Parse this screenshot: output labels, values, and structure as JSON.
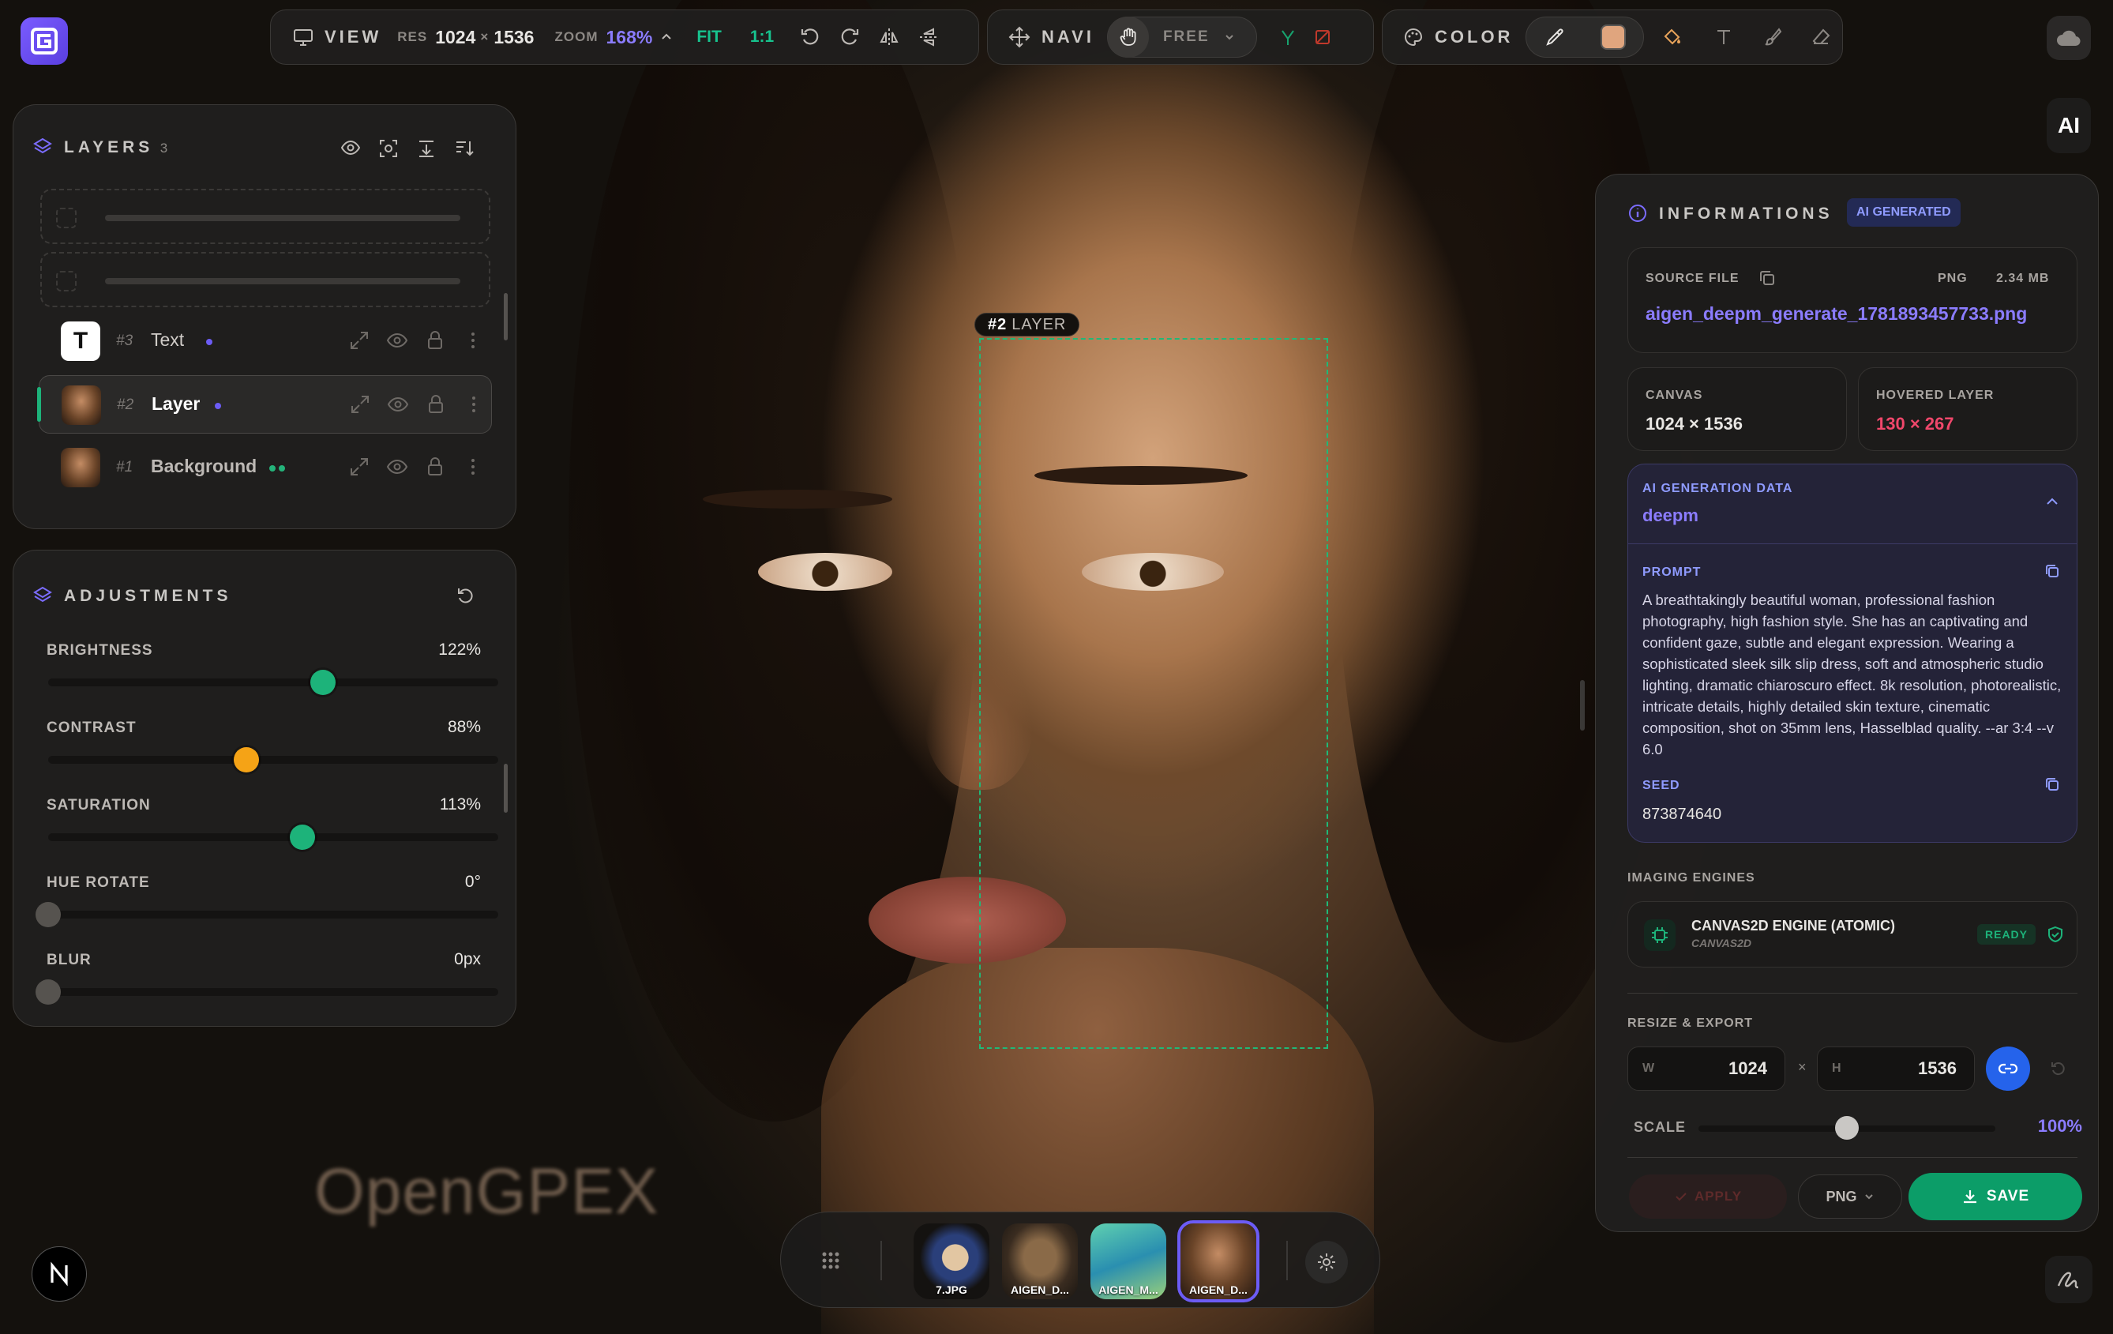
{
  "app": {
    "name": "OpenGPEX",
    "watermark": "OpenGPEX"
  },
  "toolbar": {
    "view_label": "VIEW",
    "res_label": "RES",
    "res_w": "1024",
    "res_x": "×",
    "res_h": "1536",
    "zoom_label": "ZOOM",
    "zoom_value": "168%",
    "fit_label": "FIT",
    "one_to_one_label": "1:1",
    "navi_label": "NAVI",
    "free_label": "FREE",
    "color_label": "COLOR",
    "color_swatch": "#e0a57e",
    "ai_label": "AI"
  },
  "layers": {
    "title": "LAYERS",
    "count": "3",
    "items": [
      {
        "num": "#3",
        "name": "Text",
        "thumb": "T"
      },
      {
        "num": "#2",
        "name": "Layer"
      },
      {
        "num": "#1",
        "name": "Background"
      }
    ]
  },
  "adjustments": {
    "title": "ADJUSTMENTS",
    "items": [
      {
        "label": "BRIGHTNESS",
        "value": "122%",
        "level": 0.61,
        "color": "#1db37a"
      },
      {
        "label": "CONTRAST",
        "value": "88%",
        "level": 0.44,
        "color": "#f5a316"
      },
      {
        "label": "SATURATION",
        "value": "113%",
        "level": 0.565,
        "color": "#1db37a"
      },
      {
        "label": "HUE ROTATE",
        "value": "0°",
        "level": 0.0,
        "color": "#56534f"
      },
      {
        "label": "BLUR",
        "value": "0px",
        "level": 0.0,
        "color": "#56534f"
      }
    ]
  },
  "selection": {
    "tag_num": "#2",
    "tag_label": "LAYER"
  },
  "info": {
    "title": "INFORMATIONS",
    "badge": "AI GENERATED",
    "source_label": "SOURCE FILE",
    "format": "PNG",
    "size": "2.34 MB",
    "filename": "aigen_deepm_generate_1781893457733.png",
    "canvas_label": "CANVAS",
    "canvas_value": "1024 × 1536",
    "hovered_label": "HOVERED LAYER",
    "hovered_value": "130 × 267",
    "gen_label": "AI GENERATION DATA",
    "gen_model": "deepm",
    "prompt_label": "PROMPT",
    "prompt": "A breathtakingly beautiful woman, professional fashion photography, high fashion style. She has an captivating and confident gaze, subtle and elegant expression. Wearing a sophisticated sleek silk slip dress, soft and atmospheric studio lighting, dramatic chiaroscuro effect. 8k resolution, photorealistic, intricate details, highly detailed skin texture, cinematic composition, shot on 35mm lens, Hasselblad quality. --ar 3:4 --v 6.0",
    "seed_label": "SEED",
    "seed": "873874640",
    "engines_label": "IMAGING ENGINES",
    "engine_name": "CANVAS2D ENGINE (ATOMIC)",
    "engine_sub": "CANVAS2D",
    "engine_status": "READY",
    "resize_label": "RESIZE & EXPORT",
    "w_label": "W",
    "w_value": "1024",
    "times": "×",
    "h_label": "H",
    "h_value": "1536",
    "scale_label": "SCALE",
    "scale_value": "100%",
    "scale_level": 0.5,
    "apply_label": "APPLY",
    "export_format": "PNG",
    "save_label": "SAVE"
  },
  "dock": {
    "items": [
      {
        "label": "7.JPG"
      },
      {
        "label": "AIGEN_D..."
      },
      {
        "label": "AIGEN_M..."
      },
      {
        "label": "AIGEN_D..."
      }
    ]
  }
}
